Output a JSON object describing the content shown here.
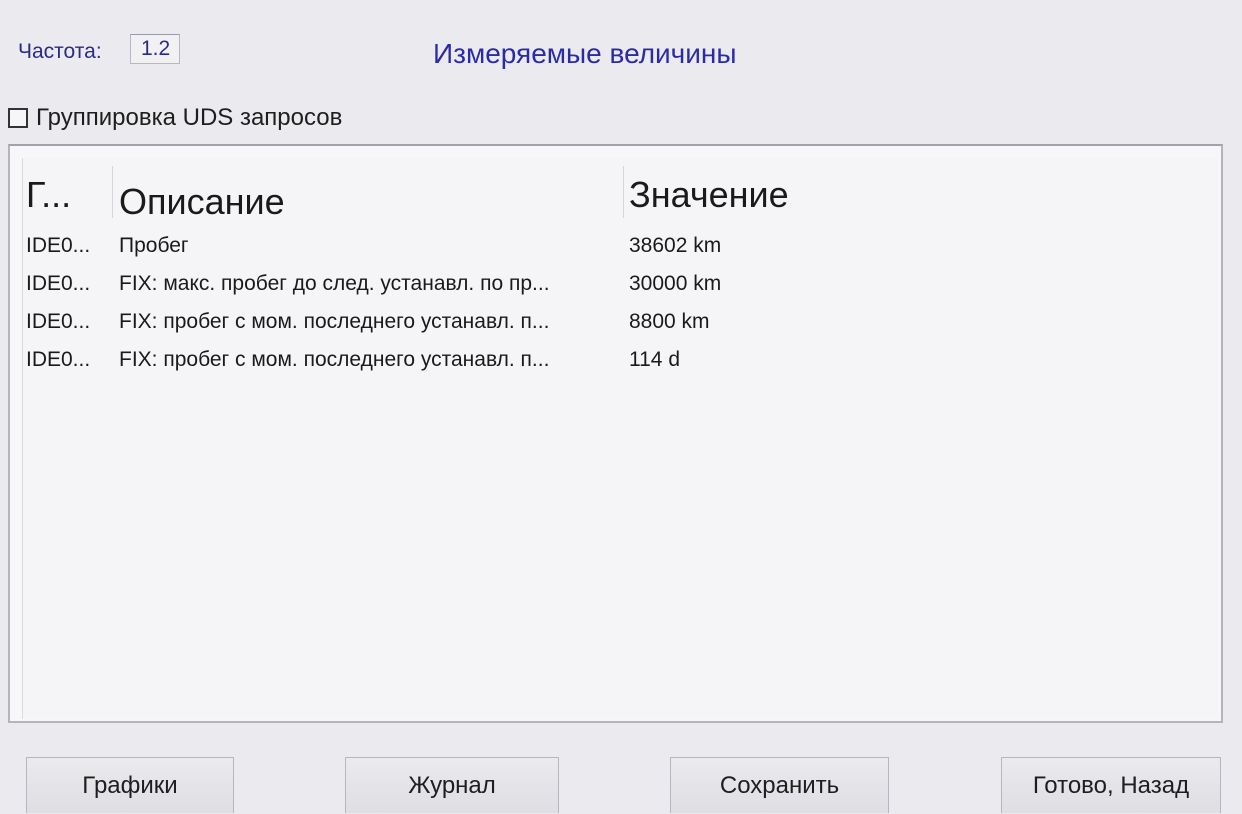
{
  "header": {
    "frequency_label": "Частота:",
    "frequency_value": "1.2",
    "title": "Измеряемые величины"
  },
  "options": {
    "grouping_label": "Группировка UDS запросов",
    "grouping_checked": false
  },
  "table": {
    "columns": [
      "Г...",
      "Описание",
      "Значение"
    ],
    "rows": [
      {
        "id": "IDE0...",
        "description": "Пробег",
        "value": "38602 km"
      },
      {
        "id": "IDE0...",
        "description": "FIX: макс. пробег до след. устанавл. по пр...",
        "value": "30000 km"
      },
      {
        "id": "IDE0...",
        "description": "FIX: пробег с мом. последнего устанавл. п...",
        "value": "8800 km"
      },
      {
        "id": "IDE0...",
        "description": "FIX: пробег с мом. последнего устанавл. п...",
        "value": "114 d"
      }
    ]
  },
  "buttons": {
    "graphs": "Графики",
    "journal": "Журнал",
    "save": "Сохранить",
    "done_back": "Готово, Назад"
  },
  "colors": {
    "title": "#2b2ba8",
    "frequency": "#2a2a8c",
    "background": "#ebebef"
  }
}
